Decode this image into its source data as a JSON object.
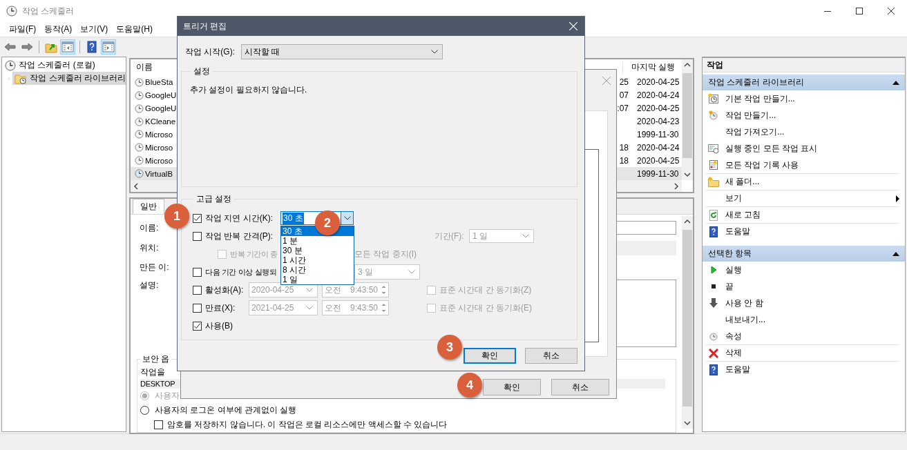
{
  "window": {
    "title": "작업 스케줄러"
  },
  "menu": [
    {
      "label": "파일(F)"
    },
    {
      "label": "동작(A)"
    },
    {
      "label": "보기(V)"
    },
    {
      "label": "도움말(H)"
    }
  ],
  "toolbar": [
    {
      "kind": "back",
      "on": false
    },
    {
      "kind": "forward",
      "on": false
    },
    {
      "kind": "up",
      "on": false
    },
    {
      "kind": "tree-pane",
      "on": true
    },
    {
      "kind": "help",
      "on": false
    },
    {
      "kind": "action-pane",
      "on": true
    }
  ],
  "tree": [
    {
      "label": "작업 스케줄러 (로컬)",
      "selected": false,
      "children": [
        {
          "label": "작업 스케줄러 라이브러리",
          "expanded": false,
          "selected": true
        }
      ]
    }
  ],
  "task_list": {
    "columns": [
      "이름",
      "마지막 실행"
    ],
    "rows": [
      {
        "name": "BlueSta",
        "column_2": "25",
        "last_run": "2020-04-25",
        "selected": false
      },
      {
        "name": "GoogleU",
        "column_2": "07",
        "last_run": "2020-04-24",
        "selected": false
      },
      {
        "name": "GoogleU",
        "column_2": ":07",
        "last_run": "2020-04-25",
        "selected": false
      },
      {
        "name": "KCleane",
        "last_run": "2020-04-23",
        "selected": false
      },
      {
        "name": "Microso",
        "last_run": "1999-11-30",
        "selected": false
      },
      {
        "name": "Microso",
        "column_2": "18",
        "last_run": "2020-04-24",
        "selected": false
      },
      {
        "name": "Microso",
        "column_2": "18",
        "last_run": "2020-04-25",
        "selected": false
      },
      {
        "name": "VirtualB",
        "last_run": "1999-11-30",
        "selected": true
      }
    ]
  },
  "details": {
    "tabs": [
      {
        "label": "일반",
        "selected": true
      }
    ],
    "fields": [
      {
        "label": "이름:",
        "kind": "text"
      },
      {
        "label": "위치:",
        "kind": "readonly"
      },
      {
        "label": "만든 이:",
        "kind": "plain"
      },
      {
        "label": "설명:",
        "kind": "multiline"
      }
    ],
    "security": {
      "title": "보안 옵",
      "prompt": "작업을",
      "account": "DESKTOP",
      "options": [
        {
          "label": "사용자",
          "selected": true,
          "disabled": true
        },
        {
          "label": "사용자의 로그온 여부에 관계없이 실행",
          "selected": false,
          "disabled": false
        }
      ],
      "no_password": {
        "label": "암호를 저장하지 않습니다. 이 작업은 로컬 리소스에만 액세스할 수 있습니다",
        "checked": false
      }
    }
  },
  "properties_dialog": {
    "buttons": [
      {
        "label": "확인"
      },
      {
        "label": "취소"
      }
    ]
  },
  "trigger_dialog": {
    "title": "트리거 편집",
    "begin": {
      "label": "작업 시작(G):",
      "value": "시작할 때"
    },
    "settings": {
      "title": "설정",
      "text": "추가 설정이 필요하지 않습니다."
    },
    "advanced": {
      "title": "고급 설정",
      "delay": {
        "label": "작업 지연 시간(K):",
        "checked": true,
        "value": "30 초",
        "options": [
          {
            "label": "30 초",
            "selected": true
          },
          {
            "label": "1 분",
            "selected": false
          },
          {
            "label": "30 분",
            "selected": false
          },
          {
            "label": "1 시간",
            "selected": false
          },
          {
            "label": "8 시간",
            "selected": false
          },
          {
            "label": "1 일",
            "selected": false
          }
        ]
      },
      "repeat": {
        "label": "작업 반복 간격(P):",
        "checked": false,
        "duration_label": "기간(F):",
        "duration_value": "1 일",
        "disabled": true
      },
      "stop_all": {
        "label_start": "반복 기간이 종",
        "label_end": "모든 작업 중지(I)",
        "checked": false,
        "disabled": true
      },
      "stop_longer": {
        "label": "다음 기간 이상 실행되",
        "checked": false,
        "value": "3 일",
        "disabled": true
      },
      "dates": [
        {
          "label": "활성화(A):",
          "checked": false,
          "date": "2020-04-25",
          "ampm": "오전",
          "time": "9:43:50",
          "sync_label": "표준 시간대 간 동기화(Z)",
          "sync_checked": false,
          "disabled": true
        },
        {
          "label": "만료(X):",
          "checked": false,
          "date": "2021-04-25",
          "ampm": "오전",
          "time": "9:43:50",
          "sync_label": "표준 시간대 간 동기화(E)",
          "sync_checked": false,
          "disabled": true
        }
      ],
      "enabled": {
        "label": "사용(B)",
        "checked": true
      }
    },
    "buttons": [
      {
        "label": "확인",
        "focused": true
      },
      {
        "label": "취소",
        "focused": false
      }
    ]
  },
  "actions": {
    "title": "작업",
    "sections": [
      {
        "title": "작업 스케줄러 라이브러리",
        "expanded": true,
        "items": [
          {
            "label": "기본 작업 만들기...",
            "kind": "wizard"
          },
          {
            "label": "작업 만들기...",
            "kind": "task"
          },
          {
            "label": "작업 가져오기...",
            "kind": "blank"
          },
          {
            "label": "실행 중인 모든 작업 표시",
            "kind": "running"
          },
          {
            "label": "모든 작업 기록 사용",
            "kind": "history"
          },
          {
            "label": "새 폴더...",
            "kind": "folder",
            "divider": true
          },
          {
            "label": "보기",
            "kind": "blank",
            "divider": true,
            "submenu": true
          },
          {
            "label": "새로 고침",
            "kind": "refresh",
            "divider": true
          },
          {
            "label": "도움말",
            "kind": "help",
            "divider": true
          }
        ]
      },
      {
        "title": "선택한 항목",
        "expanded": true,
        "items": [
          {
            "label": "실행",
            "kind": "run"
          },
          {
            "label": "끝",
            "kind": "end"
          },
          {
            "label": "사용 안 함",
            "kind": "disable"
          },
          {
            "label": "내보내기...",
            "kind": "blank"
          },
          {
            "label": "속성",
            "kind": "properties"
          },
          {
            "label": "삭제",
            "kind": "delete",
            "divider": true
          },
          {
            "label": "도움말",
            "kind": "help",
            "divider": true
          }
        ]
      }
    ]
  },
  "callouts": [
    "1",
    "2",
    "3",
    "4"
  ]
}
